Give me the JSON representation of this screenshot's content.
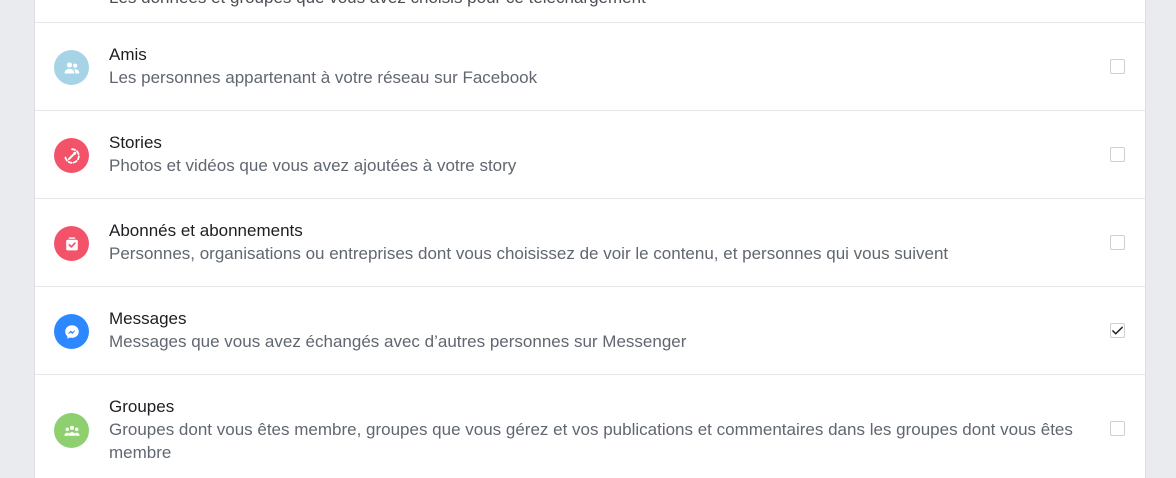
{
  "top_partial_text": "Les données et groupes que vous avez choisis pour ce téléchargement",
  "items": [
    {
      "title": "Amis",
      "description": "Les personnes appartenant à votre réseau sur Facebook",
      "icon": "friends-icon",
      "icon_color": "#a6d4e6",
      "checked": false
    },
    {
      "title": "Stories",
      "description": "Photos et vidéos que vous avez ajoutées à votre story",
      "icon": "stories-icon",
      "icon_color": "#f35369",
      "checked": false
    },
    {
      "title": "Abonnés et abonnements",
      "description": "Personnes, organisations ou entreprises dont vous choisissez de voir le contenu, et personnes qui vous suivent",
      "icon": "followers-icon",
      "icon_color": "#f35369",
      "checked": false
    },
    {
      "title": "Messages",
      "description": "Messages que vous avez échangés avec d’autres personnes sur Messenger",
      "icon": "messenger-icon",
      "icon_color": "#2d88ff",
      "checked": true
    },
    {
      "title": "Groupes",
      "description": "Groupes dont vous êtes membre, groupes que vous gérez et vos publications et commentaires dans les groupes dont vous êtes membre",
      "icon": "groups-icon",
      "icon_color": "#8ed06f",
      "checked": false
    }
  ]
}
